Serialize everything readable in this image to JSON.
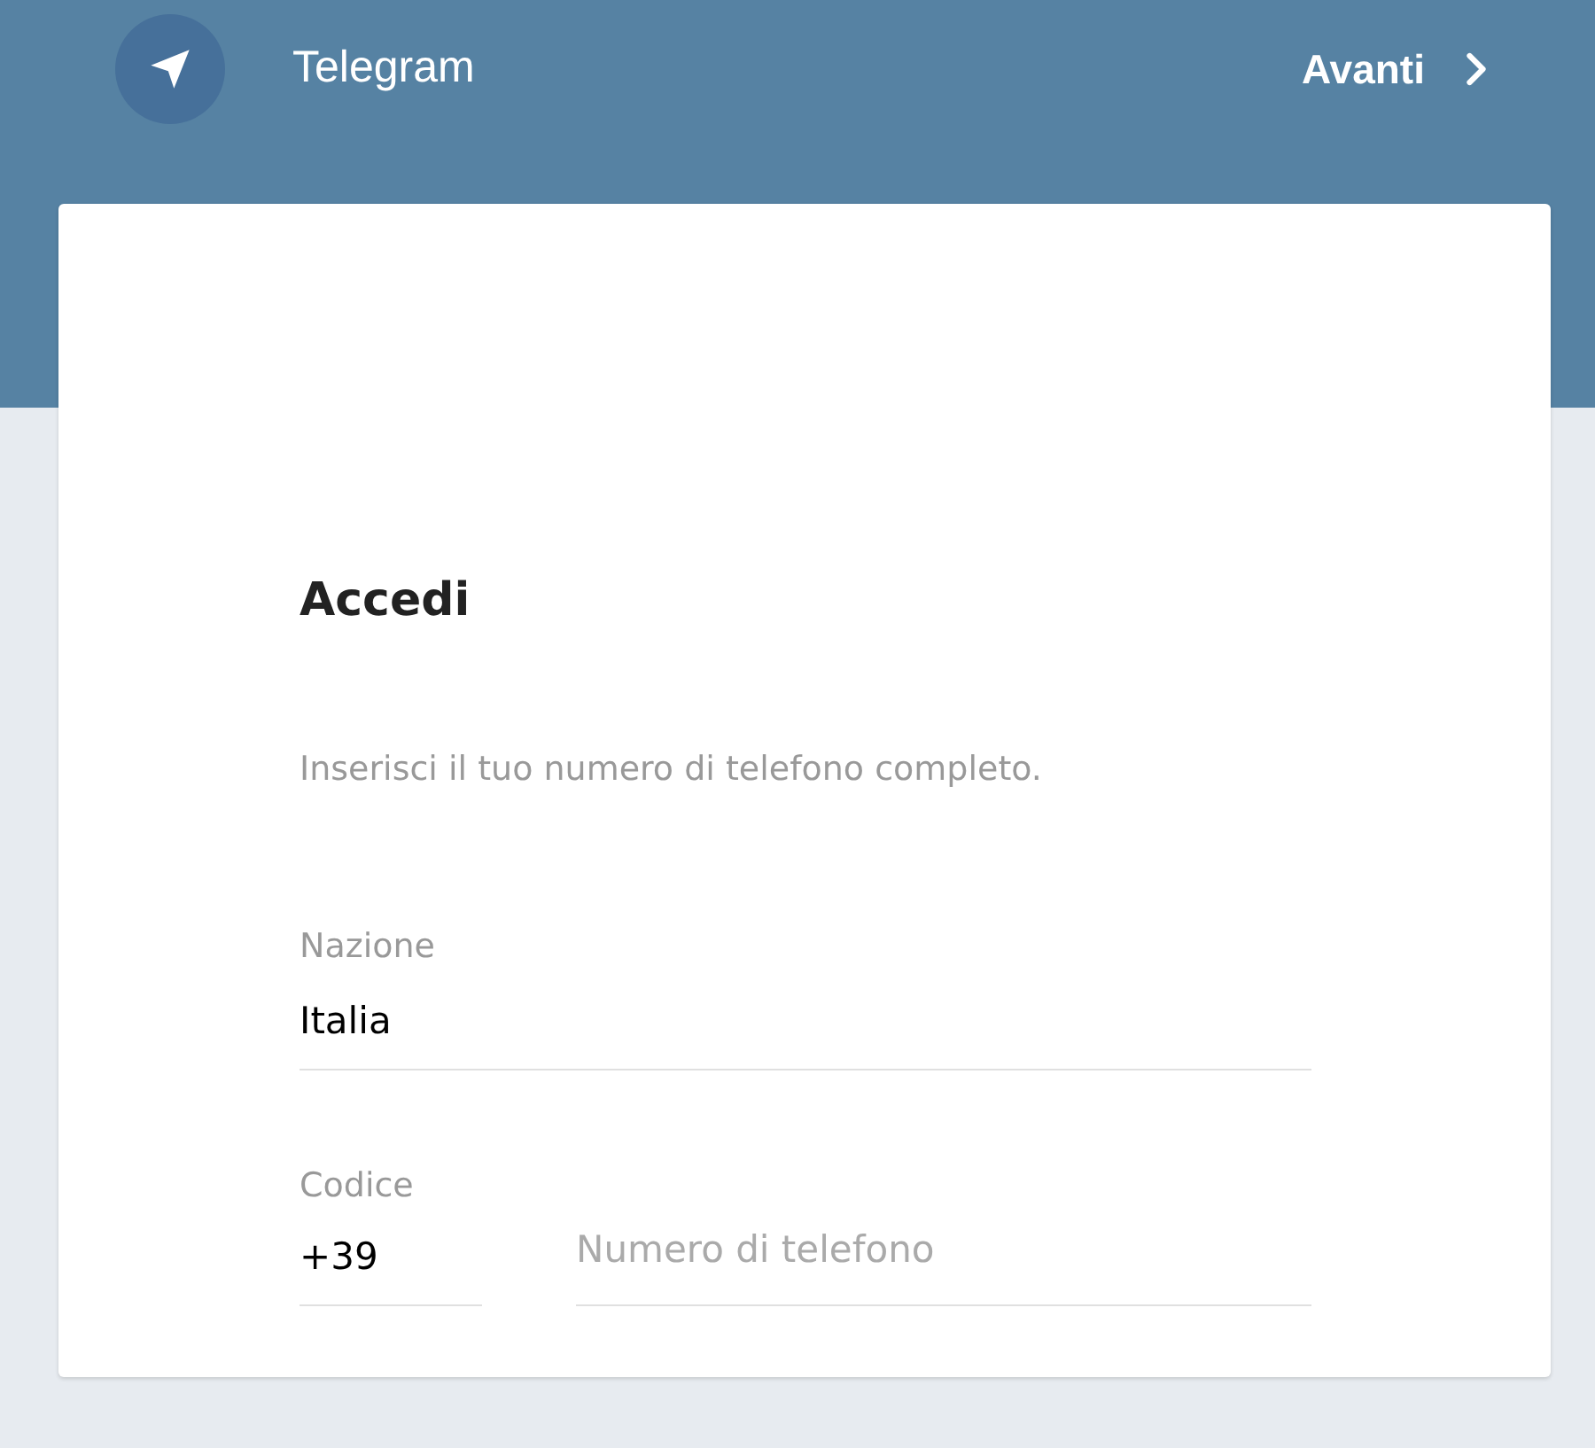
{
  "header": {
    "title": "Telegram",
    "next_button": {
      "label": "Avanti"
    }
  },
  "form": {
    "title": "Accedi",
    "subtitle": "Inserisci il tuo numero di telefono completo.",
    "country": {
      "label": "Nazione",
      "value": "Italia"
    },
    "code": {
      "label": "Codice",
      "value": "+39"
    },
    "phone": {
      "placeholder": "Numero di telefono"
    }
  }
}
